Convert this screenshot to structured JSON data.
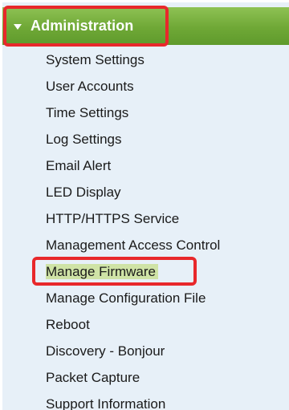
{
  "menu": {
    "header": {
      "label": "Administration",
      "expanded": true,
      "color": "#6fa836"
    },
    "items": [
      {
        "label": "System Settings"
      },
      {
        "label": "User Accounts"
      },
      {
        "label": "Time Settings"
      },
      {
        "label": "Log Settings"
      },
      {
        "label": "Email Alert"
      },
      {
        "label": "LED Display"
      },
      {
        "label": "HTTP/HTTPS Service"
      },
      {
        "label": "Management Access Control"
      },
      {
        "label": "Manage Firmware",
        "selected": true
      },
      {
        "label": "Manage Configuration File"
      },
      {
        "label": "Reboot"
      },
      {
        "label": "Discovery - Bonjour"
      },
      {
        "label": "Packet Capture"
      },
      {
        "label": "Support Information"
      }
    ],
    "highlight_color": "#e8282b"
  }
}
